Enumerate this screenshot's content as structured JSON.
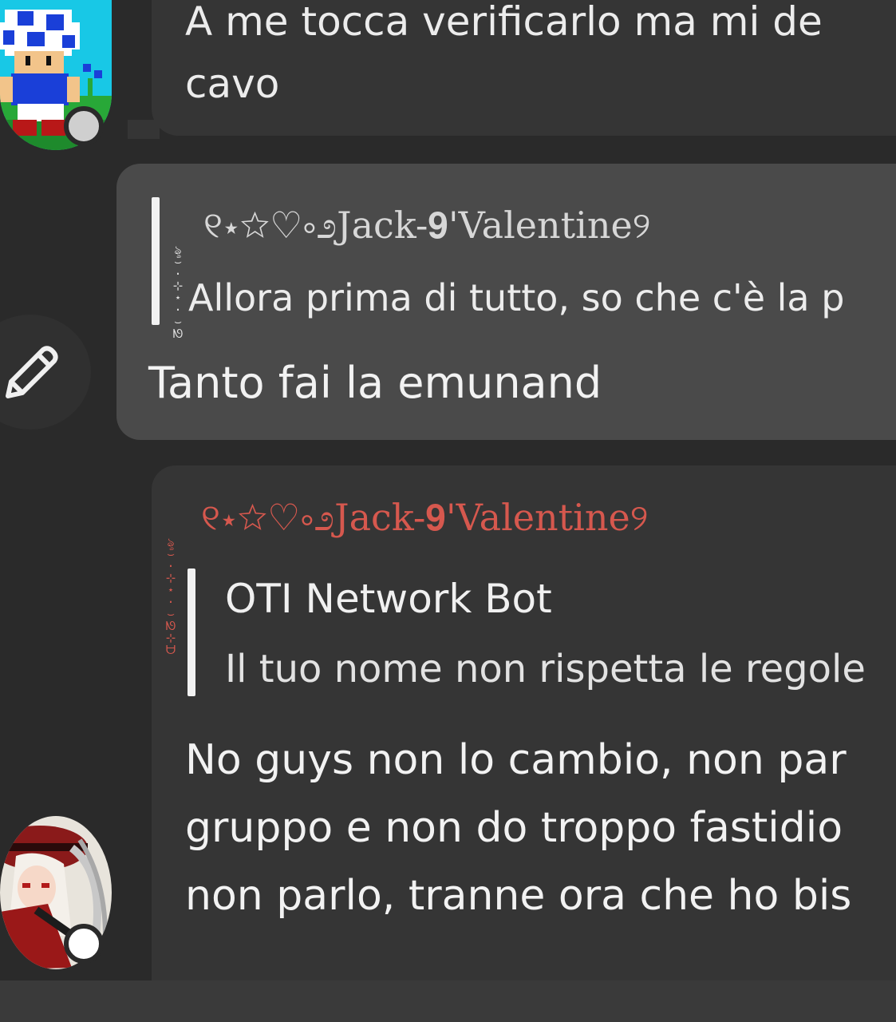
{
  "messages": {
    "top": {
      "text_line1": "A me tocca verificarlo ma mi de",
      "text_line2": "cavo"
    },
    "selected": {
      "quote_author": "୧⋆☆♡༚೨Jack-𝟗'Valentine୨",
      "quote_decoration": "ৡ⌣·⊹⋆·⌣ᘚ",
      "quote_text": "Allora prima di tutto, so che c'è la p",
      "reply_text": "Tanto fai la emunand"
    },
    "bottom": {
      "author": "୧⋆☆♡༚೨Jack-𝟗'Valentine୨",
      "author_decoration": "ৡ⌣·⊹⋆·⌣ᘚ⊹ᗨ",
      "quote_author": "OTI Network Bot",
      "quote_text": "Il tuo nome non rispetta le regole",
      "text_line1": "No guys non lo cambio, non par",
      "text_line2": "gruppo e non do troppo fastidio",
      "text_line3": "non parlo, tranne ora che ho bis"
    }
  },
  "avatars": {
    "user_1": "pixel-toad-avatar",
    "user_2": "anime-character-avatar",
    "status_1_color": "#cfcfcf",
    "status_2_color": "#ffffff"
  },
  "colors": {
    "background": "#2a2a2a",
    "bubble": "#353535",
    "selected_bubble": "#4a4a4a",
    "author_accent": "#d6584e",
    "quote_bar": "#f2f2f2"
  },
  "icons": {
    "edit": "pencil-icon"
  }
}
